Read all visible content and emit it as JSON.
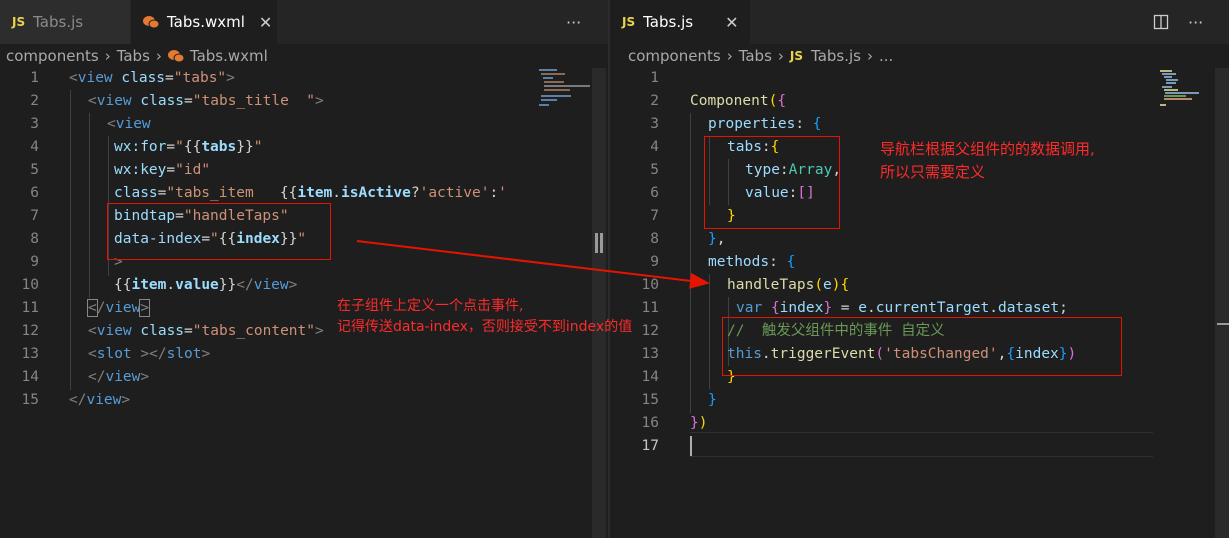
{
  "left": {
    "tabs": [
      {
        "label": "Tabs.js",
        "icon": "JS",
        "active": false
      },
      {
        "label": "Tabs.wxml",
        "icon": "wechat",
        "active": true
      }
    ],
    "more": "···",
    "close": "✕",
    "breadcrumb": [
      "components",
      "Tabs",
      "Tabs.wxml"
    ],
    "lines": [
      "1",
      "2",
      "3",
      "4",
      "5",
      "6",
      "7",
      "8",
      "9",
      "10",
      "11",
      "12",
      "13",
      "14",
      "15"
    ]
  },
  "right": {
    "tab": {
      "label": "Tabs.js",
      "icon": "JS"
    },
    "close": "✕",
    "more": "···",
    "breadcrumb": [
      "components",
      "Tabs",
      "Tabs.js",
      "..."
    ],
    "lines": [
      "1",
      "2",
      "3",
      "4",
      "5",
      "6",
      "7",
      "8",
      "9",
      "10",
      "11",
      "12",
      "13",
      "14",
      "15",
      "16",
      "17"
    ]
  },
  "annotations": {
    "left_note_line1": "在子组件上定义一个点击事件,",
    "left_note_line2": "记得传送data-index，否则接受不到index的值",
    "right_note_line1": "导航栏根据父组件的的数据调用,",
    "right_note_line2": "所以只需要定义"
  },
  "colors": {
    "annotation": "#ff2a2a",
    "box": "#e51400",
    "background": "#1e1e1e"
  }
}
